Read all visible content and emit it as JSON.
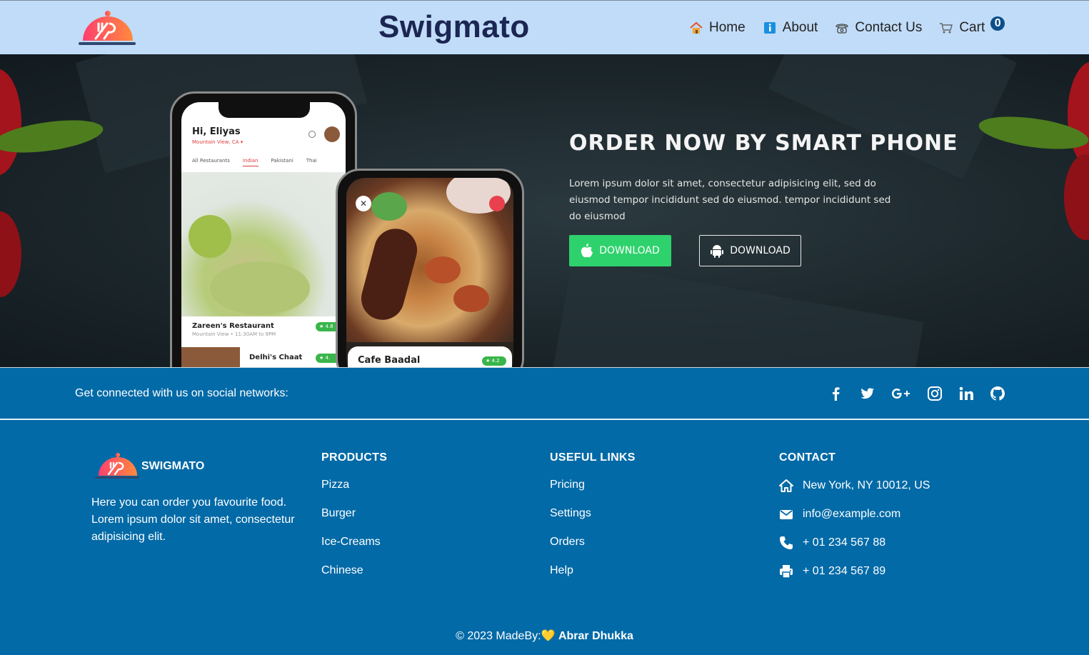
{
  "navbar": {
    "brand": "Swigmato",
    "items": [
      {
        "label": "Home",
        "icon": "home-icon"
      },
      {
        "label": "About",
        "icon": "info-icon"
      },
      {
        "label": "Contact Us",
        "icon": "phone-icon"
      },
      {
        "label": "Cart",
        "icon": "cart-icon"
      }
    ],
    "cart_count": "0"
  },
  "hero": {
    "title": "ORDER NOW BY SMART PHONE",
    "text": "Lorem ipsum dolor sit amet, consectetur adipisicing elit, sed do eiusmod tempor incididunt sed do eiusmod. tempor incididunt sed do eiusmod",
    "apple_button": "DOWNLOAD",
    "android_button": "DOWNLOAD",
    "phone1": {
      "greeting": "Hi, Eliyas",
      "location": "Mountain View, CA ▾",
      "tabs": [
        "All Restaurants",
        "Indian",
        "Pakistani",
        "Thai"
      ],
      "restaurant": "Zareen's Restaurant",
      "restaurant_meta": "Mountain View  •  11:30AM to 9PM",
      "rating": "★ 4.8",
      "next_restaurant": "Delhi's Chaat",
      "next_rating": "★ 4."
    },
    "phone2": {
      "restaurant": "Cafe Baadal",
      "rating": "★ 4.2"
    }
  },
  "social": {
    "text": "Get connected with us on social networks:",
    "icons": [
      "facebook-icon",
      "twitter-icon",
      "google-plus-icon",
      "instagram-icon",
      "linkedin-icon",
      "github-icon"
    ]
  },
  "footer": {
    "brand": "SWIGMATO",
    "about": "Here you can order you favourite food. Lorem ipsum dolor sit amet, consectetur adipisicing elit.",
    "products": {
      "title": "PRODUCTS",
      "links": [
        "Pizza",
        "Burger",
        "Ice-Creams",
        "Chinese"
      ]
    },
    "useful": {
      "title": "USEFUL LINKS",
      "links": [
        "Pricing",
        "Settings",
        "Orders",
        "Help"
      ]
    },
    "contact": {
      "title": "CONTACT",
      "address": "New York, NY 10012, US",
      "email": "info@example.com",
      "phone": "+ 01 234 567 88",
      "fax": "+ 01 234 567 89"
    },
    "copyright_prefix": "© 2023 MadeBy:",
    "heart": "💛",
    "author": "Abrar Dhukka"
  },
  "colors": {
    "navbar_bg": "#c1dcf8",
    "brand_text": "#1b2653",
    "footer_bg": "#026aa7",
    "green_button": "#2ed26c",
    "logo_gradient_start": "#ff5f6d",
    "logo_gradient_end": "#ff8a3d"
  }
}
